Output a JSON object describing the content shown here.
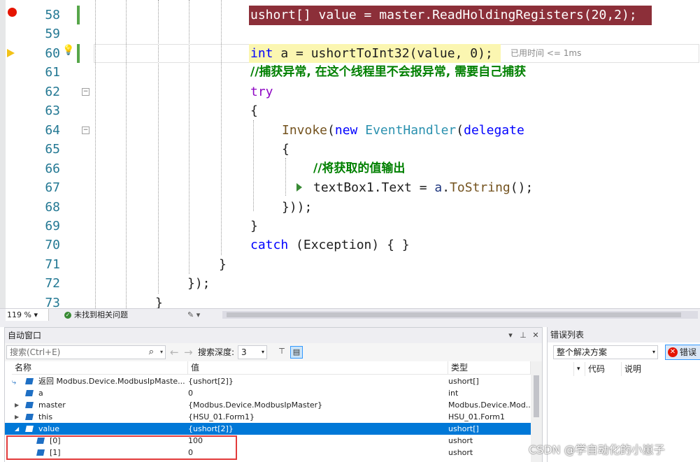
{
  "editor": {
    "elapsed_hint": "已用时间 <= 1ms",
    "lines": [
      {
        "num": "58"
      },
      {
        "num": "59"
      },
      {
        "num": "60"
      },
      {
        "num": "61"
      },
      {
        "num": "62"
      },
      {
        "num": "63"
      },
      {
        "num": "64"
      },
      {
        "num": "65"
      },
      {
        "num": "66"
      },
      {
        "num": "67"
      },
      {
        "num": "68"
      },
      {
        "num": "69"
      },
      {
        "num": "70"
      },
      {
        "num": "71"
      },
      {
        "num": "72"
      },
      {
        "num": "73"
      }
    ],
    "code": {
      "l58": "ushort[] value = master.ReadHoldingRegisters(20,2);",
      "l60_kw": "int",
      "l60_rest": " a = ushortToInt32(value, 0);",
      "l61": "//捕获异常, 在这个线程里不会报异常, 需要自己捕获",
      "l62": "try",
      "l63": "{",
      "l64_fn": "Invoke",
      "l64_p1": "(",
      "l64_new": "new",
      "l64_ty": " EventHandler",
      "l64_p2": "(",
      "l64_del": "delegate",
      "l65": "{",
      "l66": "//将获取的值输出",
      "l67_a": "textBox1.Text = ",
      "l67_b": "a",
      "l67_c": ".",
      "l67_fn": "ToString",
      "l67_d": "();",
      "l68": "}));",
      "l69": "}",
      "l70_kw": "catch",
      "l70_rest": " (Exception) { }",
      "l71": "}",
      "l72": "});",
      "l73": "}"
    }
  },
  "statusbar": {
    "zoom": "119 %",
    "zoom_drop": "▾",
    "issues": "未找到相关问题",
    "ok_icon": "✓",
    "brush": "✎ ▾"
  },
  "autos": {
    "title": "自动窗口",
    "search_placeholder": "搜索(Ctrl+E)",
    "search_icon": "⌕",
    "drop": "▾",
    "back": "←",
    "forward": "→",
    "depth_label": "搜索深度:",
    "depth_value": "3",
    "controls": {
      "menu": "▾",
      "pin": "⊥",
      "close": "✕"
    },
    "columns": {
      "name": "名称",
      "value": "值",
      "type": "类型"
    },
    "rows": [
      {
        "name": "返回 Modbus.Device.ModbusIpMaste...",
        "value": "{ushort[2]}",
        "type": "ushort[]"
      },
      {
        "name": "a",
        "value": "0",
        "type": "int"
      },
      {
        "name": "master",
        "value": "{Modbus.Device.ModbusIpMaster}",
        "type": "Modbus.Device.Mod..."
      },
      {
        "name": "this",
        "value": "{HSU_01.Form1}",
        "type": "HSU_01.Form1"
      },
      {
        "name": "value",
        "value": "{ushort[2]}",
        "type": "ushort[]"
      },
      {
        "name": "[0]",
        "value": "100",
        "type": "ushort"
      },
      {
        "name": "[1]",
        "value": "0",
        "type": "ushort"
      }
    ]
  },
  "errors": {
    "title": "错误列表",
    "scope": "整个解决方案",
    "error_btn": "错误",
    "col_code": "代码",
    "col_desc": "说明"
  },
  "watermark": "CSDN @学自动化的小崽子"
}
